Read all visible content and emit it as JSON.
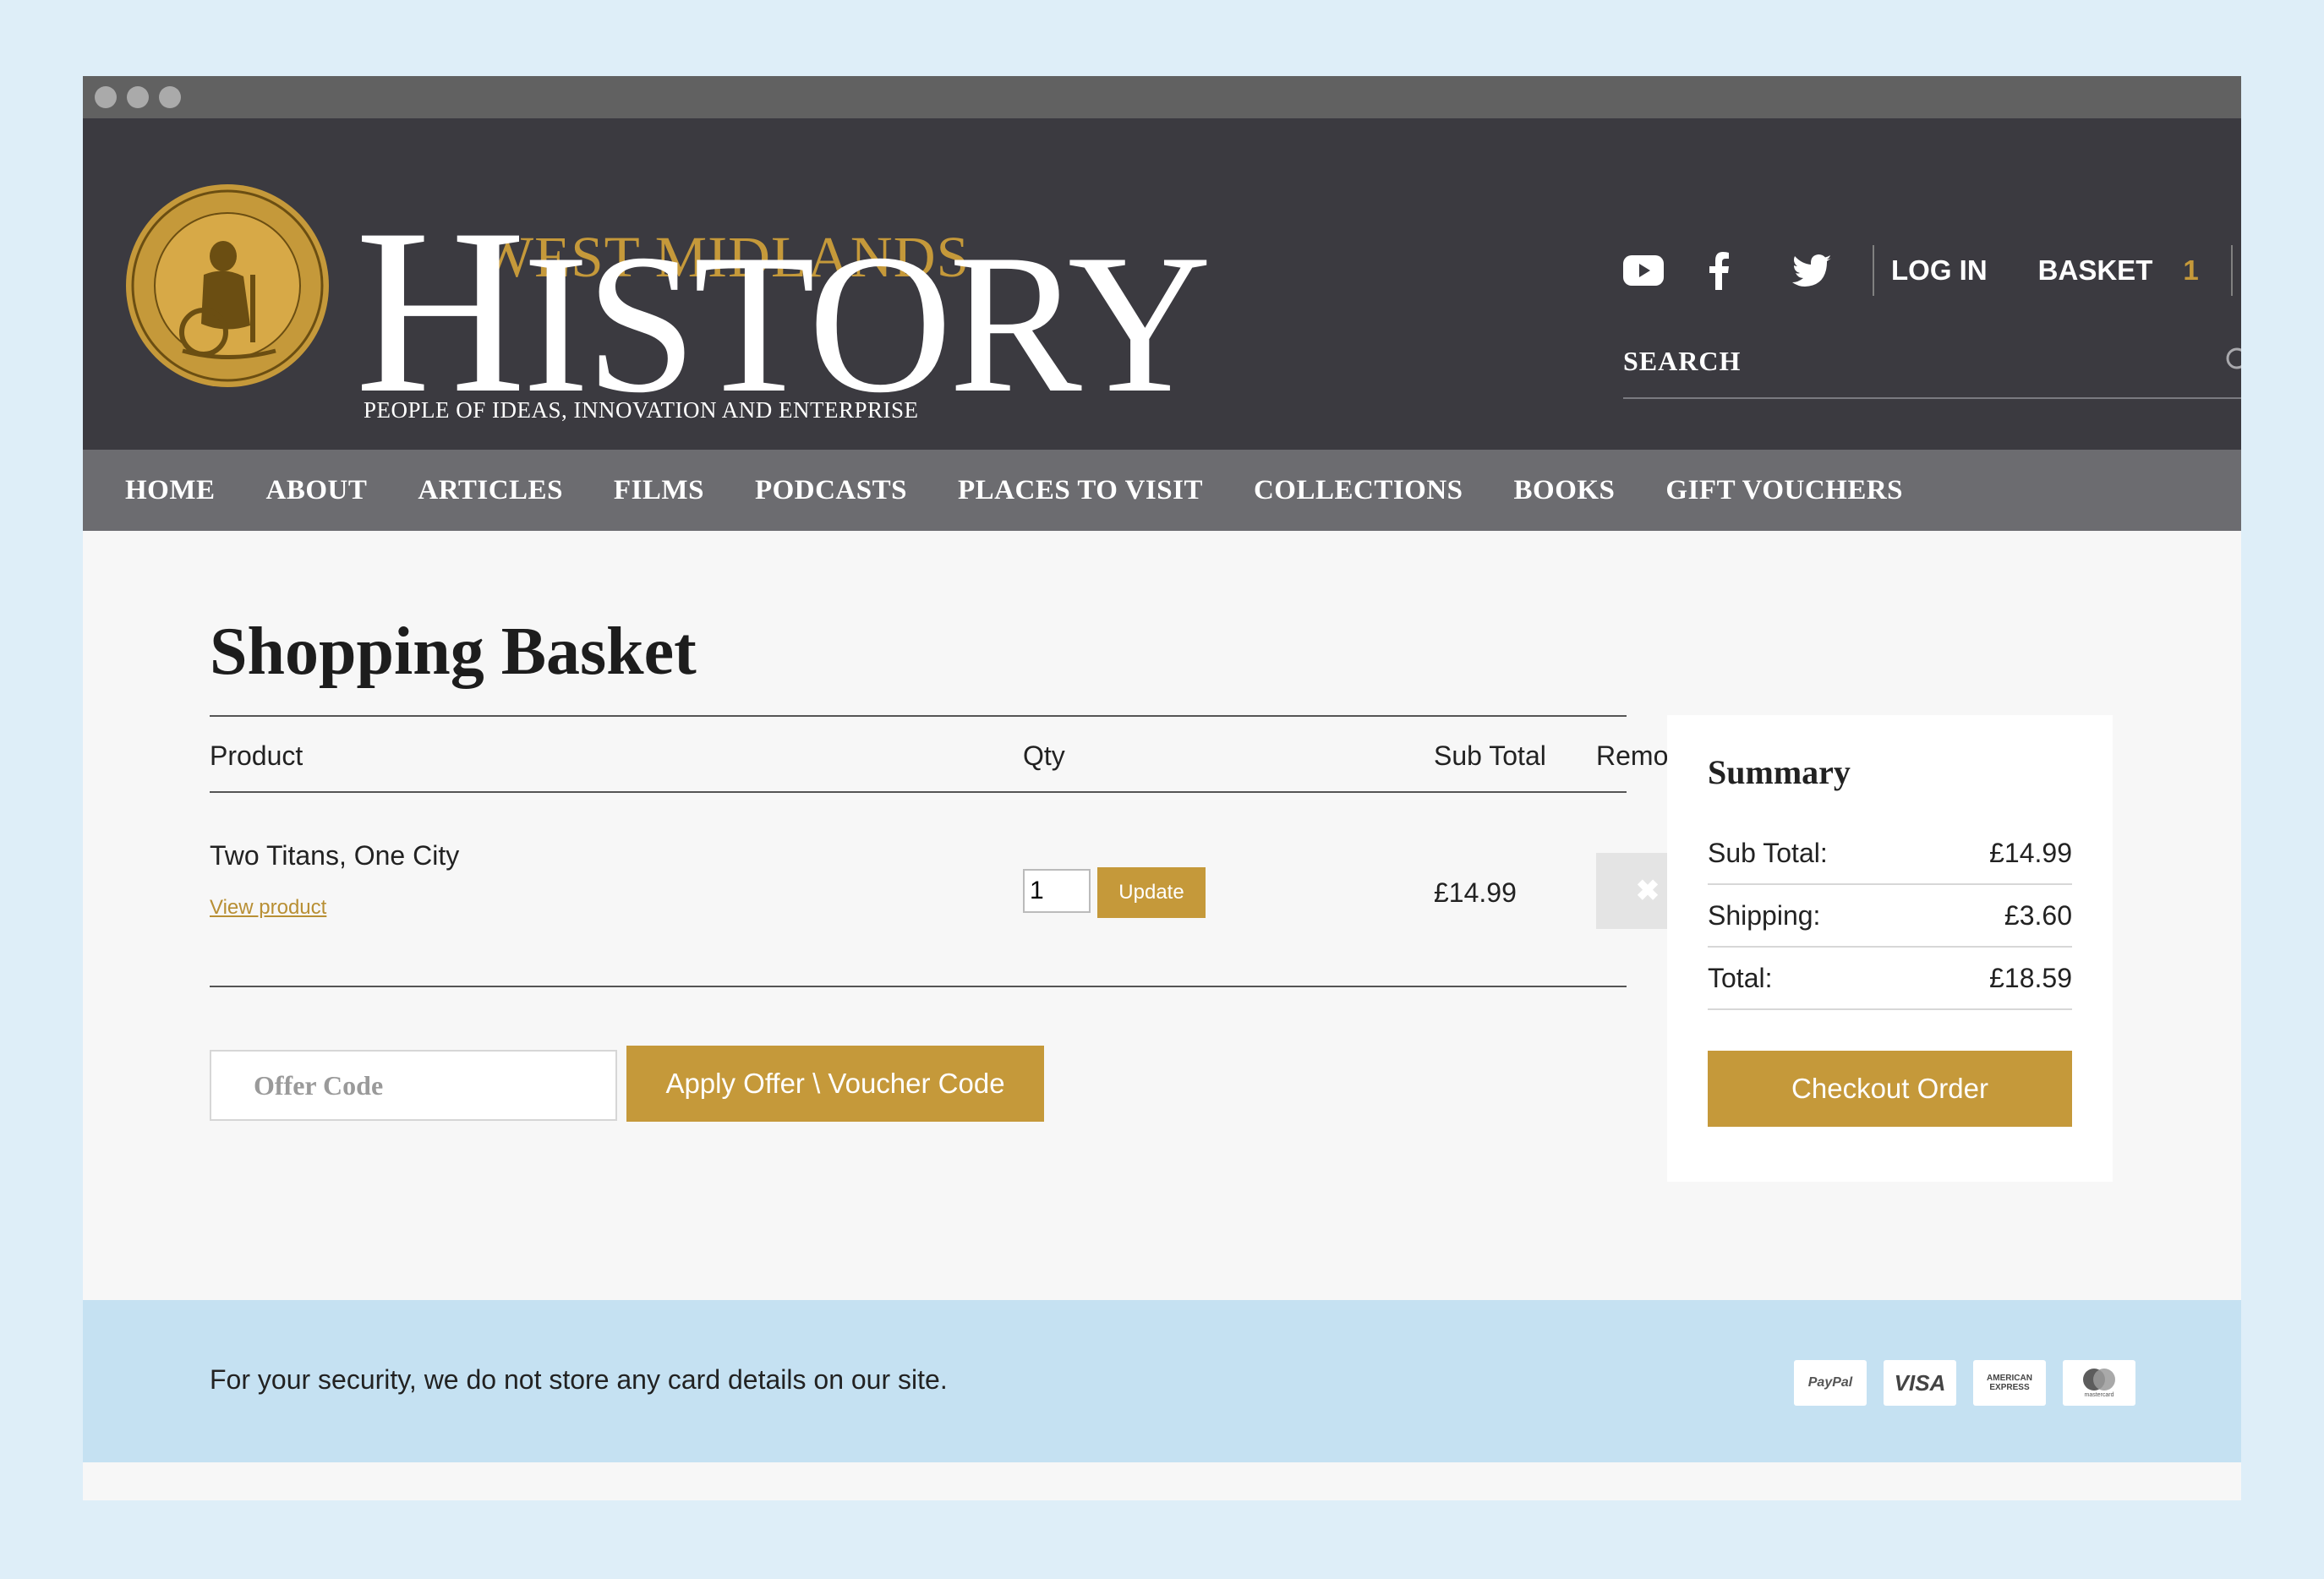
{
  "window": {
    "controls": [
      "close",
      "minimize",
      "maximize"
    ]
  },
  "logo": {
    "line1": "WEST MIDLANDS",
    "line2_cap": "H",
    "line2_rest": "ISTORY",
    "tagline": "PEOPLE OF IDEAS, INNOVATION AND ENTERPRISE",
    "seal_text": "HISTORY WEST MIDLANDS"
  },
  "header": {
    "social_icons": [
      "youtube-icon",
      "facebook-icon",
      "twitter-icon"
    ],
    "login_label": "LOG IN",
    "basket_label": "BASKET",
    "basket_count": "1",
    "search_placeholder": "SEARCH"
  },
  "nav": {
    "items": [
      "HOME",
      "ABOUT",
      "ARTICLES",
      "FILMS",
      "PODCASTS",
      "PLACES TO VISIT",
      "COLLECTIONS",
      "BOOKS",
      "GIFT VOUCHERS"
    ]
  },
  "basket": {
    "title": "Shopping Basket",
    "columns": {
      "product": "Product",
      "qty": "Qty",
      "subtotal": "Sub Total",
      "remove": "Remove"
    },
    "items": [
      {
        "name": "Two Titans, One City",
        "link_label": "View product",
        "qty": "1",
        "update_label": "Update",
        "subtotal": "£14.99",
        "remove_glyph": "✖"
      }
    ],
    "offer_placeholder": "Offer Code",
    "offer_button": "Apply Offer \\ Voucher Code"
  },
  "summary": {
    "title": "Summary",
    "rows": [
      {
        "label": "Sub Total:",
        "value": "£14.99"
      },
      {
        "label": "Shipping:",
        "value": "£3.60"
      },
      {
        "label": "Total:",
        "value": "£18.59"
      }
    ],
    "checkout_label": "Checkout Order"
  },
  "footer": {
    "security_text": "For your security, we do not store any card details on our site.",
    "cards": [
      "PayPal",
      "VISA",
      "AMERICAN EXPRESS",
      "mastercard"
    ]
  },
  "colors": {
    "accent": "#c5993a",
    "header_bg": "#3b3a40",
    "nav_bg": "#6c6c70",
    "footer_band": "#c5e1f2"
  }
}
